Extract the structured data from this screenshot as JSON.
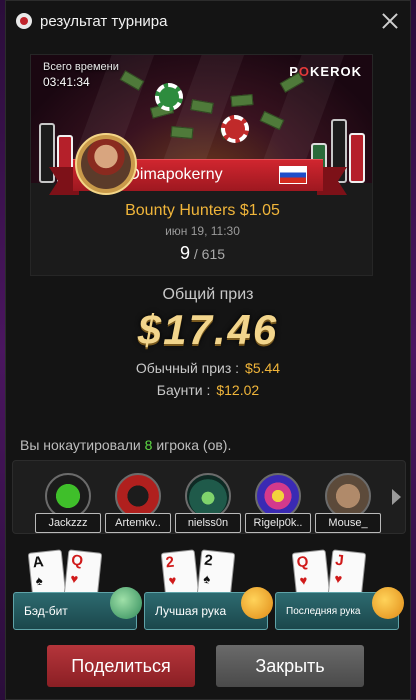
{
  "window": {
    "title": "результат турнира"
  },
  "banner": {
    "time_label": "Всего времени",
    "time_value": "03:41:34",
    "logo_prefix": "P",
    "logo_o": "O",
    "logo_suffix": "KEROK"
  },
  "player": {
    "name": "Dimapokerny",
    "flag": "russia-flag-icon"
  },
  "tournament": {
    "name": "Bounty Hunters $1.05",
    "date": "июн 19, 11:30",
    "place": "9",
    "place_total": "/ 615"
  },
  "prize": {
    "label": "Общий приз",
    "amount": "$17.46",
    "regular_label": "Обычный приз :",
    "regular_amount": "$5.44",
    "bounty_label": "Баунти :",
    "bounty_amount": "$12.02"
  },
  "knockouts": {
    "text_before": "Вы нокаутировали",
    "count": "8",
    "text_after": "игрока (ов).",
    "players": [
      {
        "name": "Jackzzz",
        "avatar": "clover-avatar"
      },
      {
        "name": "Artemkv..",
        "avatar": "bull-avatar"
      },
      {
        "name": "nielss0n",
        "avatar": "hooded-figure-avatar"
      },
      {
        "name": "Rigelp0k..",
        "avatar": "mandala-avatar"
      },
      {
        "name": "Mouse_",
        "avatar": "photo-avatar"
      }
    ]
  },
  "hands": [
    {
      "label": "Бэд-бит",
      "cards": [
        {
          "rank": "A",
          "suit": "♠",
          "color": "black"
        },
        {
          "rank": "Q",
          "suit": "♥",
          "color": "red"
        }
      ]
    },
    {
      "label": "Лучшая рука",
      "cards": [
        {
          "rank": "2",
          "suit": "♥",
          "color": "red"
        },
        {
          "rank": "2",
          "suit": "♠",
          "color": "black"
        }
      ]
    },
    {
      "label": "Последняя рука",
      "cards": [
        {
          "rank": "Q",
          "suit": "♥",
          "color": "red"
        },
        {
          "rank": "J",
          "suit": "♥",
          "color": "red"
        }
      ]
    }
  ],
  "buttons": {
    "share": "Поделиться",
    "close": "Закрыть"
  }
}
